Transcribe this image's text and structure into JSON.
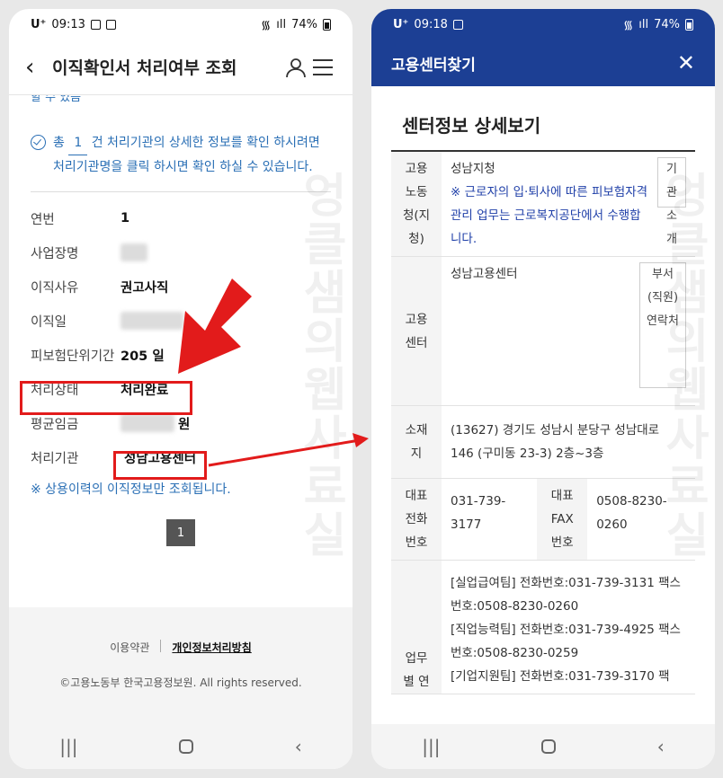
{
  "left": {
    "status": {
      "carrier": "U⁺",
      "time": "09:13",
      "battery": "74%"
    },
    "header": {
      "title": "이직확인서 처리여부 조회"
    },
    "cut_text": "할 수 있음",
    "notice": {
      "prefix": "총",
      "count": "1",
      "text": "건 처리기관의 상세한 정보를 확인 하시려면 처리기관명을 클릭 하시면 확인 하실 수 있습니다."
    },
    "rows": [
      {
        "label": "연번",
        "value": "1"
      },
      {
        "label": "사업장명",
        "value": ""
      },
      {
        "label": "이직사유",
        "value": "권고사직"
      },
      {
        "label": "이직일",
        "value": ""
      },
      {
        "label": "피보험단위기간",
        "value": "205 일"
      },
      {
        "label": "처리상태",
        "value": "처리완료"
      },
      {
        "label": "평균임금",
        "value": "원"
      },
      {
        "label": "처리기관",
        "value": "성남고용센터"
      }
    ],
    "footnote": "※ 상용이력의 이직정보만 조회됩니다.",
    "pager": {
      "current": "1"
    },
    "footer": {
      "terms": "이용약관",
      "privacy": "개인정보처리방침",
      "copyright": "©고용노동부 한국고용정보원. All rights reserved."
    }
  },
  "right": {
    "status": {
      "carrier": "U⁺",
      "time": "09:18",
      "battery": "74%"
    },
    "header": {
      "title": "고용센터찾기",
      "close": "✕"
    },
    "section_title": "센터정보 상세보기",
    "ministry": {
      "label": "고용노동청(지청)",
      "name": "성남지청",
      "note": "※ 근로자의 입·퇴사에 따른 피보험자격 관리 업무는 근로복지공단에서 수행합니다.",
      "button": "기관소개"
    },
    "center": {
      "label": "고용센터",
      "name": "성남고용센터",
      "button": "부서(직원)연락처"
    },
    "address": {
      "label": "소재지",
      "value": "(13627) 경기도 성남시 분당구 성남대로 146 (구미동 23-3) 2층~3층"
    },
    "phone": {
      "label": "대표전화번호",
      "value": "031-739-3177",
      "fax_label": "대표FAX번호",
      "fax_value": "0508-8230-0260"
    },
    "teams": {
      "label": "업무별 연",
      "lines": [
        "[실업급여팀] 전화번호:031-739-3131 팩스번호:0508-8230-0260",
        "[직업능력팀] 전화번호:031-739-4925 팩스번호:0508-8230-0259",
        "[기업지원팀] 전화번호:031-739-3170 팩"
      ]
    }
  },
  "watermark": "엉클샘의웹사료실",
  "colors": {
    "header_blue": "#1c3f94",
    "link_blue": "#2a6fb5",
    "annotation_red": "#e21b1b"
  }
}
